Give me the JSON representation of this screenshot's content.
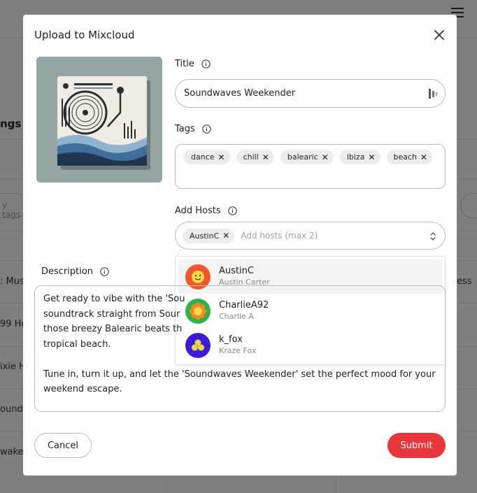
{
  "background": {
    "section_title": "ngs",
    "tags_placeholder": "y tags",
    "rows": [
      {
        "left": ": Musi",
        "right": "ess"
      },
      {
        "left": "99 Ho",
        "right": ""
      },
      {
        "left": "ixie H",
        "right": ""
      },
      {
        "left": "ound",
        "right": ""
      },
      {
        "left": "wake",
        "right": ""
      }
    ]
  },
  "modal": {
    "title": "Upload to Mixcloud",
    "fields": {
      "title_label": "Title",
      "title_value": "Soundwaves Weekender",
      "tags_label": "Tags",
      "tags": [
        "dance",
        "chill",
        "balearic",
        "ibiza",
        "beach"
      ],
      "hosts_label": "Add Hosts",
      "selected_hosts": [
        "AustinC"
      ],
      "hosts_placeholder": "Add hosts (max 2)",
      "description_label": "Description",
      "description_paragraphs": [
        "Get ready to vibe with the 'Sou… soundtrack straight from Sour… those breezy Balearic beats th… tropical beach.",
        "Tune in, turn it up, and let the 'Soundwaves Weekender' set the perfect mood for your weekend escape."
      ],
      "description_lines_1": [
        "Get ready to vibe with the 'Sou",
        "soundtrack straight from Sour",
        "those breezy Balearic beats th",
        "tropical beach."
      ],
      "description_lines_2": [
        "Tune in, turn it up, and let the 'Soundwaves Weekender' set the perfect mood for your",
        "weekend escape."
      ]
    },
    "host_options": [
      {
        "username": "AustinC",
        "full_name": "Austin Carter",
        "avatar_color": "#f2572b",
        "highlighted": true
      },
      {
        "username": "CharlieA92",
        "full_name": "Charlie A",
        "avatar_color": "#2fb24c",
        "highlighted": false
      },
      {
        "username": "k_fox",
        "full_name": "Kraze Fox",
        "avatar_color": "#3d1bd9",
        "highlighted": false
      }
    ],
    "buttons": {
      "cancel": "Cancel",
      "submit": "Submit"
    }
  },
  "colors": {
    "accent": "#e8373a",
    "overlay": "rgba(0,0,0,0.5)",
    "chip_bg": "#ececec"
  },
  "icons": {
    "close": "close-icon",
    "info": "info-icon",
    "chip_remove": "x-icon",
    "select": "chevron-up-down-icon",
    "title_field": "password-manager-icon"
  }
}
